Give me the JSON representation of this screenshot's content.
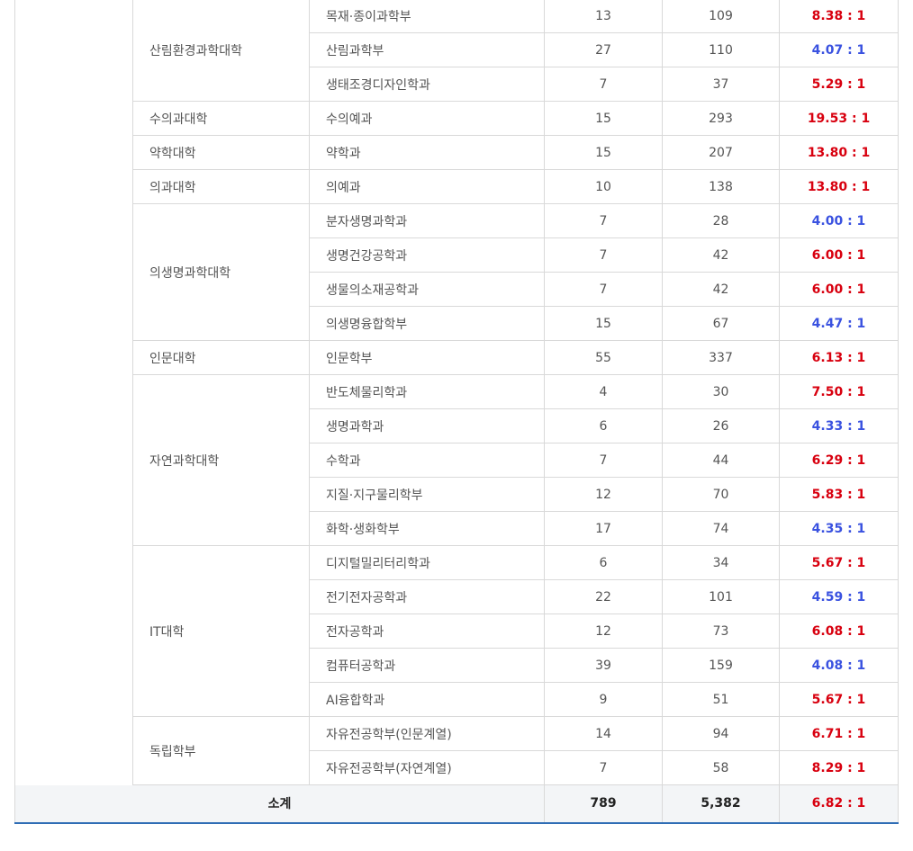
{
  "colors": {
    "high": "#d8000f",
    "low": "#3a52e0",
    "accent": "#2f6db5"
  },
  "groups": [
    {
      "college": "산림환경과학대학",
      "rows": [
        {
          "dept": "목재·종이과학부",
          "quota": "13",
          "applicants": "109",
          "ratio": "8.38 : 1",
          "level": "high"
        },
        {
          "dept": "산림과학부",
          "quota": "27",
          "applicants": "110",
          "ratio": "4.07 : 1",
          "level": "low"
        },
        {
          "dept": "생태조경디자인학과",
          "quota": "7",
          "applicants": "37",
          "ratio": "5.29 : 1",
          "level": "high"
        }
      ]
    },
    {
      "college": "수의과대학",
      "rows": [
        {
          "dept": "수의예과",
          "quota": "15",
          "applicants": "293",
          "ratio": "19.53 : 1",
          "level": "high"
        }
      ]
    },
    {
      "college": "약학대학",
      "rows": [
        {
          "dept": "약학과",
          "quota": "15",
          "applicants": "207",
          "ratio": "13.80 : 1",
          "level": "high"
        }
      ]
    },
    {
      "college": "의과대학",
      "rows": [
        {
          "dept": "의예과",
          "quota": "10",
          "applicants": "138",
          "ratio": "13.80 : 1",
          "level": "high"
        }
      ]
    },
    {
      "college": "의생명과학대학",
      "rows": [
        {
          "dept": "분자생명과학과",
          "quota": "7",
          "applicants": "28",
          "ratio": "4.00 : 1",
          "level": "low"
        },
        {
          "dept": "생명건강공학과",
          "quota": "7",
          "applicants": "42",
          "ratio": "6.00 : 1",
          "level": "high"
        },
        {
          "dept": "생물의소재공학과",
          "quota": "7",
          "applicants": "42",
          "ratio": "6.00 : 1",
          "level": "high"
        },
        {
          "dept": "의생명융합학부",
          "quota": "15",
          "applicants": "67",
          "ratio": "4.47 : 1",
          "level": "low"
        }
      ]
    },
    {
      "college": "인문대학",
      "rows": [
        {
          "dept": "인문학부",
          "quota": "55",
          "applicants": "337",
          "ratio": "6.13 : 1",
          "level": "high"
        }
      ]
    },
    {
      "college": "자연과학대학",
      "rows": [
        {
          "dept": "반도체물리학과",
          "quota": "4",
          "applicants": "30",
          "ratio": "7.50 : 1",
          "level": "high"
        },
        {
          "dept": "생명과학과",
          "quota": "6",
          "applicants": "26",
          "ratio": "4.33 : 1",
          "level": "low"
        },
        {
          "dept": "수학과",
          "quota": "7",
          "applicants": "44",
          "ratio": "6.29 : 1",
          "level": "high"
        },
        {
          "dept": "지질·지구물리학부",
          "quota": "12",
          "applicants": "70",
          "ratio": "5.83 : 1",
          "level": "high"
        },
        {
          "dept": "화학·생화학부",
          "quota": "17",
          "applicants": "74",
          "ratio": "4.35 : 1",
          "level": "low"
        }
      ]
    },
    {
      "college": "IT대학",
      "rows": [
        {
          "dept": "디지털밀리터리학과",
          "quota": "6",
          "applicants": "34",
          "ratio": "5.67 : 1",
          "level": "high"
        },
        {
          "dept": "전기전자공학과",
          "quota": "22",
          "applicants": "101",
          "ratio": "4.59 : 1",
          "level": "low"
        },
        {
          "dept": "전자공학과",
          "quota": "12",
          "applicants": "73",
          "ratio": "6.08 : 1",
          "level": "high"
        },
        {
          "dept": "컴퓨터공학과",
          "quota": "39",
          "applicants": "159",
          "ratio": "4.08 : 1",
          "level": "low"
        },
        {
          "dept": "AI융합학과",
          "quota": "9",
          "applicants": "51",
          "ratio": "5.67 : 1",
          "level": "high"
        }
      ]
    },
    {
      "college": "독립학부",
      "rows": [
        {
          "dept": "자유전공학부(인문계열)",
          "quota": "14",
          "applicants": "94",
          "ratio": "6.71 : 1",
          "level": "high"
        },
        {
          "dept": "자유전공학부(자연계열)",
          "quota": "7",
          "applicants": "58",
          "ratio": "8.29 : 1",
          "level": "high"
        }
      ]
    }
  ],
  "total": {
    "label": "소계",
    "quota": "789",
    "applicants": "5,382",
    "ratio": "6.82 : 1",
    "level": "high"
  }
}
